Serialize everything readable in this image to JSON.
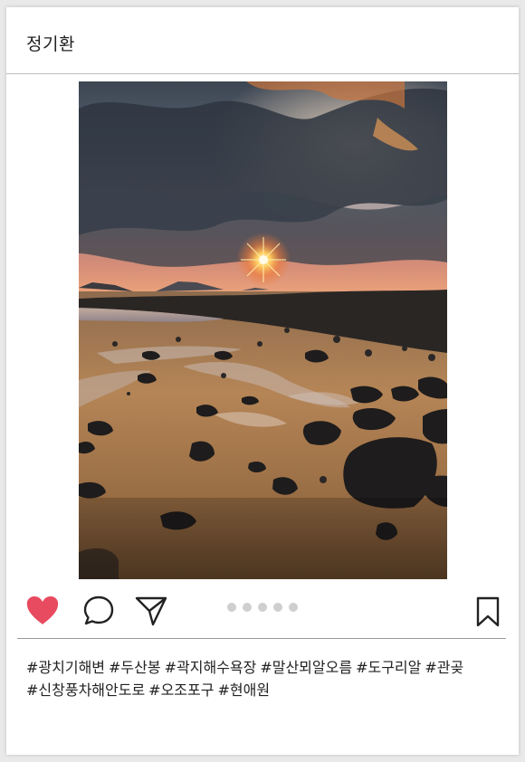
{
  "post": {
    "username": "정기환",
    "photo_icon": "sunset-beach-photo"
  },
  "actions": {
    "like_icon": "heart-icon",
    "comment_icon": "speech-bubble-icon",
    "share_icon": "paper-plane-icon",
    "save_icon": "bookmark-icon",
    "liked": true,
    "like_color": "#e84a5f",
    "carousel_count": 5
  },
  "caption": {
    "hashtags": [
      "#광치기해변",
      "#두산봉",
      "#곽지해수욕장",
      "#말산뫼알오름",
      "#도구리알",
      "#관곶",
      "#신창풍차해안도로",
      "#오조포구",
      "#현애원"
    ]
  }
}
